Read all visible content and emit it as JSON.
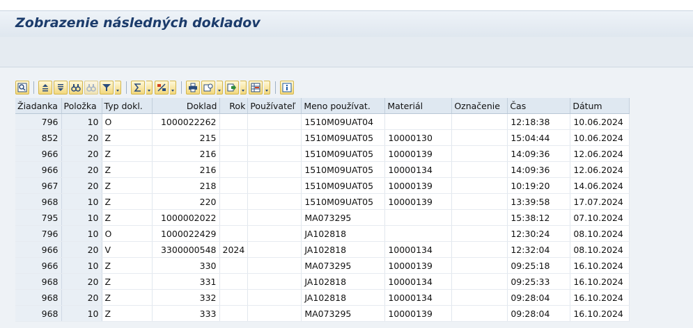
{
  "window": {
    "title": "Zobrazenie následných dokladov"
  },
  "toolbar": {
    "buttons": [
      {
        "name": "details-icon",
        "glyph": "🔍"
      },
      {
        "name": "sort-ascending-icon",
        "glyph": "↑"
      },
      {
        "name": "sort-descending-icon",
        "glyph": "↓"
      },
      {
        "name": "find-icon",
        "glyph": "⌘"
      },
      {
        "name": "find-next-icon",
        "glyph": "⌘"
      },
      {
        "name": "filter-icon",
        "glyph": "▽"
      },
      {
        "name": "total-icon",
        "glyph": "Σ"
      },
      {
        "name": "subtotal-icon",
        "glyph": "%"
      },
      {
        "name": "print-icon",
        "glyph": "⎙"
      },
      {
        "name": "views-icon",
        "glyph": "▤"
      },
      {
        "name": "export-icon",
        "glyph": "⇨"
      },
      {
        "name": "layout-icon",
        "glyph": "▦"
      },
      {
        "name": "information-icon",
        "glyph": "i"
      }
    ]
  },
  "table": {
    "columns": [
      "Žiadanka",
      "Položka",
      "Typ dokl.",
      "Doklad",
      "Rok",
      "Používateľ",
      "Meno používat.",
      "Materiál",
      "Označenie",
      "Čas",
      "Dátum"
    ],
    "rows": [
      [
        "796",
        "10",
        "O",
        "1000022262",
        "",
        "",
        "1510M09UAT04",
        "",
        "",
        "12:18:38",
        "10.06.2024"
      ],
      [
        "852",
        "20",
        "Z",
        "215",
        "",
        "",
        "1510M09UAT05",
        "10000130",
        "",
        "15:04:44",
        "10.06.2024"
      ],
      [
        "966",
        "20",
        "Z",
        "216",
        "",
        "",
        "1510M09UAT05",
        "10000139",
        "",
        "14:09:36",
        "12.06.2024"
      ],
      [
        "966",
        "20",
        "Z",
        "216",
        "",
        "",
        "1510M09UAT05",
        "10000134",
        "",
        "14:09:36",
        "12.06.2024"
      ],
      [
        "967",
        "20",
        "Z",
        "218",
        "",
        "",
        "1510M09UAT05",
        "10000139",
        "",
        "10:19:20",
        "14.06.2024"
      ],
      [
        "968",
        "10",
        "Z",
        "220",
        "",
        "",
        "1510M09UAT05",
        "10000139",
        "",
        "13:39:58",
        "17.07.2024"
      ],
      [
        "795",
        "10",
        "Z",
        "1000002022",
        "",
        "",
        "MA073295",
        "",
        "",
        "15:38:12",
        "07.10.2024"
      ],
      [
        "796",
        "10",
        "O",
        "1000022429",
        "",
        "",
        "JA102818",
        "",
        "",
        "12:30:24",
        "08.10.2024"
      ],
      [
        "966",
        "20",
        "V",
        "3300000548",
        "2024",
        "",
        "JA102818",
        "10000134",
        "",
        "12:32:04",
        "08.10.2024"
      ],
      [
        "966",
        "10",
        "Z",
        "330",
        "",
        "",
        "MA073295",
        "10000139",
        "",
        "09:25:18",
        "16.10.2024"
      ],
      [
        "968",
        "20",
        "Z",
        "331",
        "",
        "",
        "JA102818",
        "10000134",
        "",
        "09:25:33",
        "16.10.2024"
      ],
      [
        "968",
        "20",
        "Z",
        "332",
        "",
        "",
        "JA102818",
        "10000134",
        "",
        "09:28:04",
        "16.10.2024"
      ],
      [
        "968",
        "10",
        "Z",
        "333",
        "",
        "",
        "MA073295",
        "10000139",
        "",
        "09:28:04",
        "16.10.2024"
      ]
    ]
  },
  "colors": {
    "title_text": "#1b3b6b",
    "header_bg": "#dfe8f1",
    "key_cell_bg": "#e9eff5",
    "toolbar_button": "#f2d77d"
  }
}
